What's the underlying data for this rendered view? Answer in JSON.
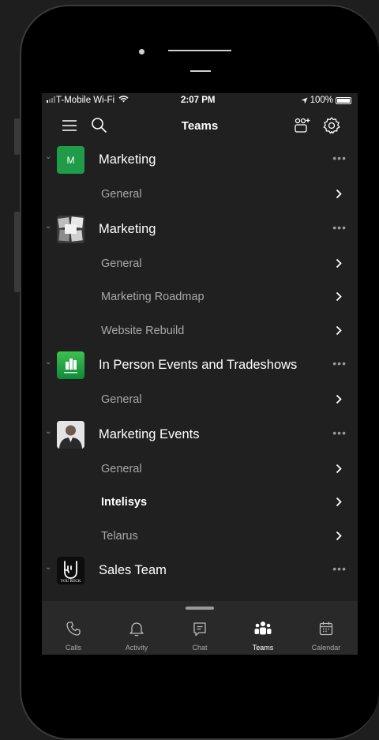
{
  "status": {
    "carrier": "T-Mobile Wi-Fi",
    "time": "2:07 PM",
    "battery": "100%"
  },
  "header": {
    "title": "Teams"
  },
  "teams": [
    {
      "name": "Marketing",
      "avatar_text": "M",
      "channels": [
        {
          "label": "General"
        }
      ]
    },
    {
      "name": "Marketing",
      "channels": [
        {
          "label": "General"
        },
        {
          "label": "Marketing Roadmap"
        },
        {
          "label": "Website Rebuild"
        }
      ]
    },
    {
      "name": "In Person Events and Tradeshows",
      "channels": [
        {
          "label": "General"
        }
      ]
    },
    {
      "name": "Marketing Events",
      "channels": [
        {
          "label": "General"
        },
        {
          "label": "Intelisys",
          "unread": true
        },
        {
          "label": "Telarus"
        }
      ]
    },
    {
      "name": "Sales Team",
      "avatar_text": "YOU ROCK",
      "channels": []
    }
  ],
  "tabs": [
    {
      "label": "Calls",
      "icon": "phone-icon"
    },
    {
      "label": "Activity",
      "icon": "bell-icon"
    },
    {
      "label": "Chat",
      "icon": "chat-icon"
    },
    {
      "label": "Teams",
      "icon": "teams-icon",
      "active": true
    },
    {
      "label": "Calendar",
      "icon": "calendar-icon"
    }
  ],
  "colors": {
    "accent_green": "#20a04a",
    "background": "#202020",
    "tabbar": "#292929"
  }
}
